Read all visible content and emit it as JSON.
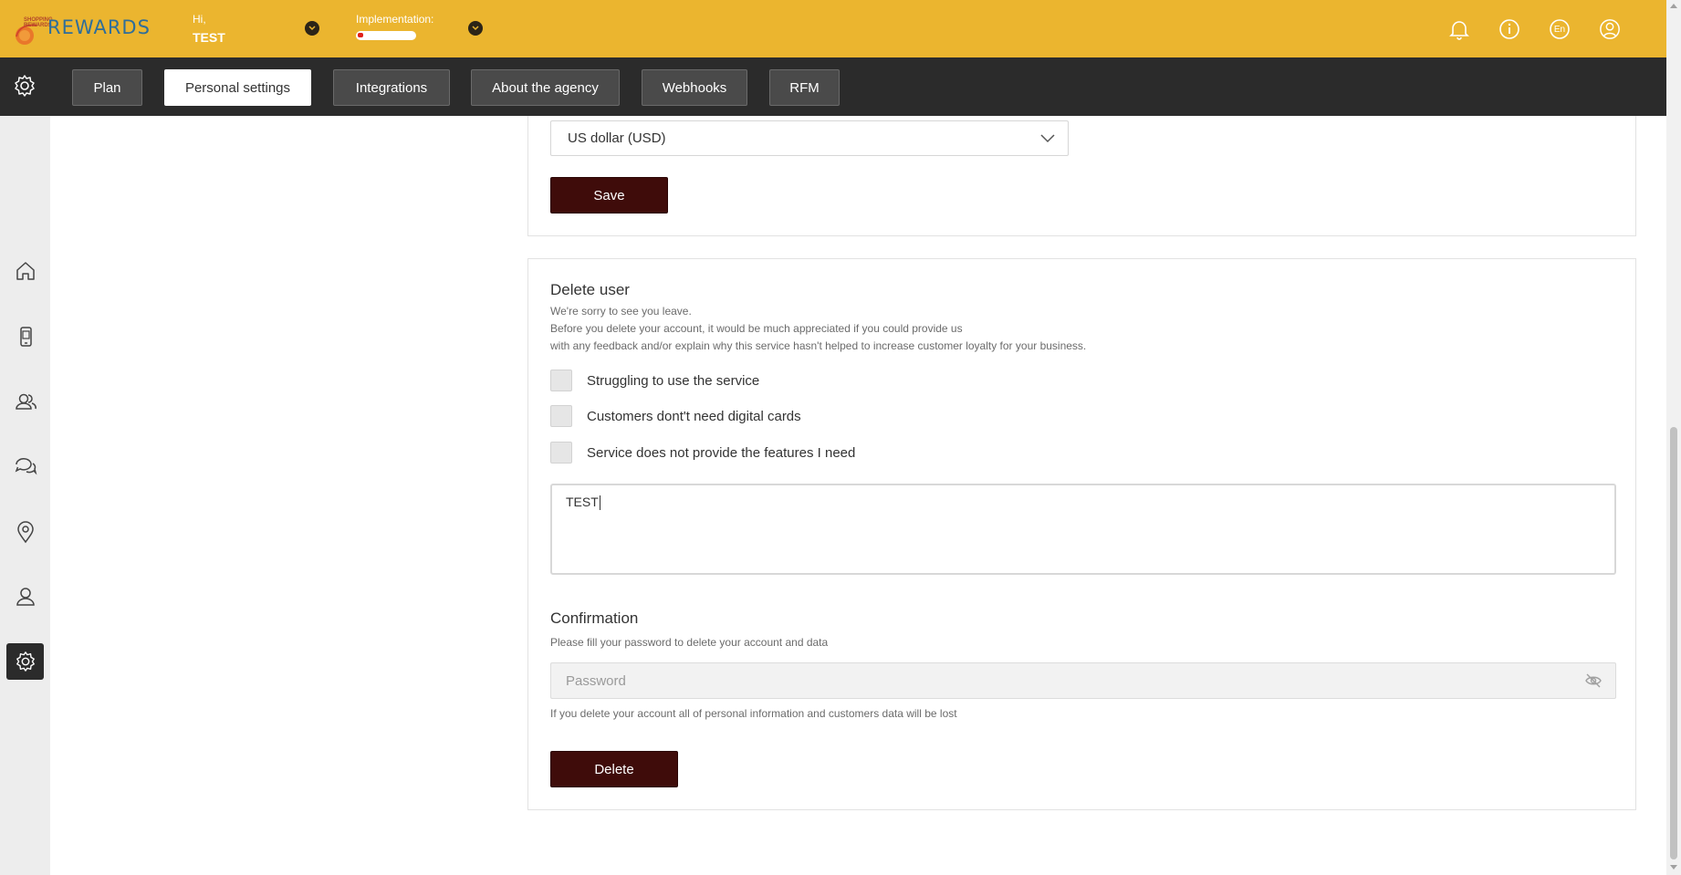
{
  "header": {
    "logo_small_text": "SHOPPING REWARDS",
    "logo_text": "REWARDS",
    "greeting": "Hi,",
    "user_name": "TEST",
    "implementation_label": "Implementation:",
    "implementation_progress": 0.1,
    "language": "En",
    "icons": [
      "bell-icon",
      "info-icon",
      "language-icon",
      "user-account-icon"
    ]
  },
  "nav": {
    "tabs": [
      {
        "label": "Plan",
        "active": false
      },
      {
        "label": "Personal settings",
        "active": true
      },
      {
        "label": "Integrations",
        "active": false
      },
      {
        "label": "About the agency",
        "active": false
      },
      {
        "label": "Webhooks",
        "active": false
      },
      {
        "label": "RFM",
        "active": false
      }
    ]
  },
  "sidebar": {
    "items": [
      "home-icon",
      "mobile-card-icon",
      "customers-icon",
      "chat-icon",
      "location-icon",
      "user-icon",
      "settings-icon"
    ],
    "active": "settings-icon"
  },
  "currency": {
    "selected": "US dollar (USD)",
    "save_label": "Save"
  },
  "delete_user": {
    "title": "Delete user",
    "line1": "We're sorry to see you leave.",
    "line2": "Before you delete your account, it would be much appreciated if you could provide us",
    "line3": "with any feedback and/or explain why this service hasn't helped to increase customer loyalty for your business.",
    "reasons": [
      "Struggling to use the service",
      "Customers dont't need digital cards",
      "Service does not provide the features I need"
    ],
    "feedback_value": "TEST",
    "confirmation_title": "Confirmation",
    "confirmation_text": "Please fill your password to delete your account and data",
    "password_placeholder": "Password",
    "warning": "If you delete your account all of personal information and customers data will be lost",
    "delete_label": "Delete"
  },
  "colors": {
    "header_bg": "#ebb52f",
    "nav_bg": "#2b2b2b",
    "button_dark": "#3f0c0a",
    "logo_blue": "#2f6e9a"
  }
}
